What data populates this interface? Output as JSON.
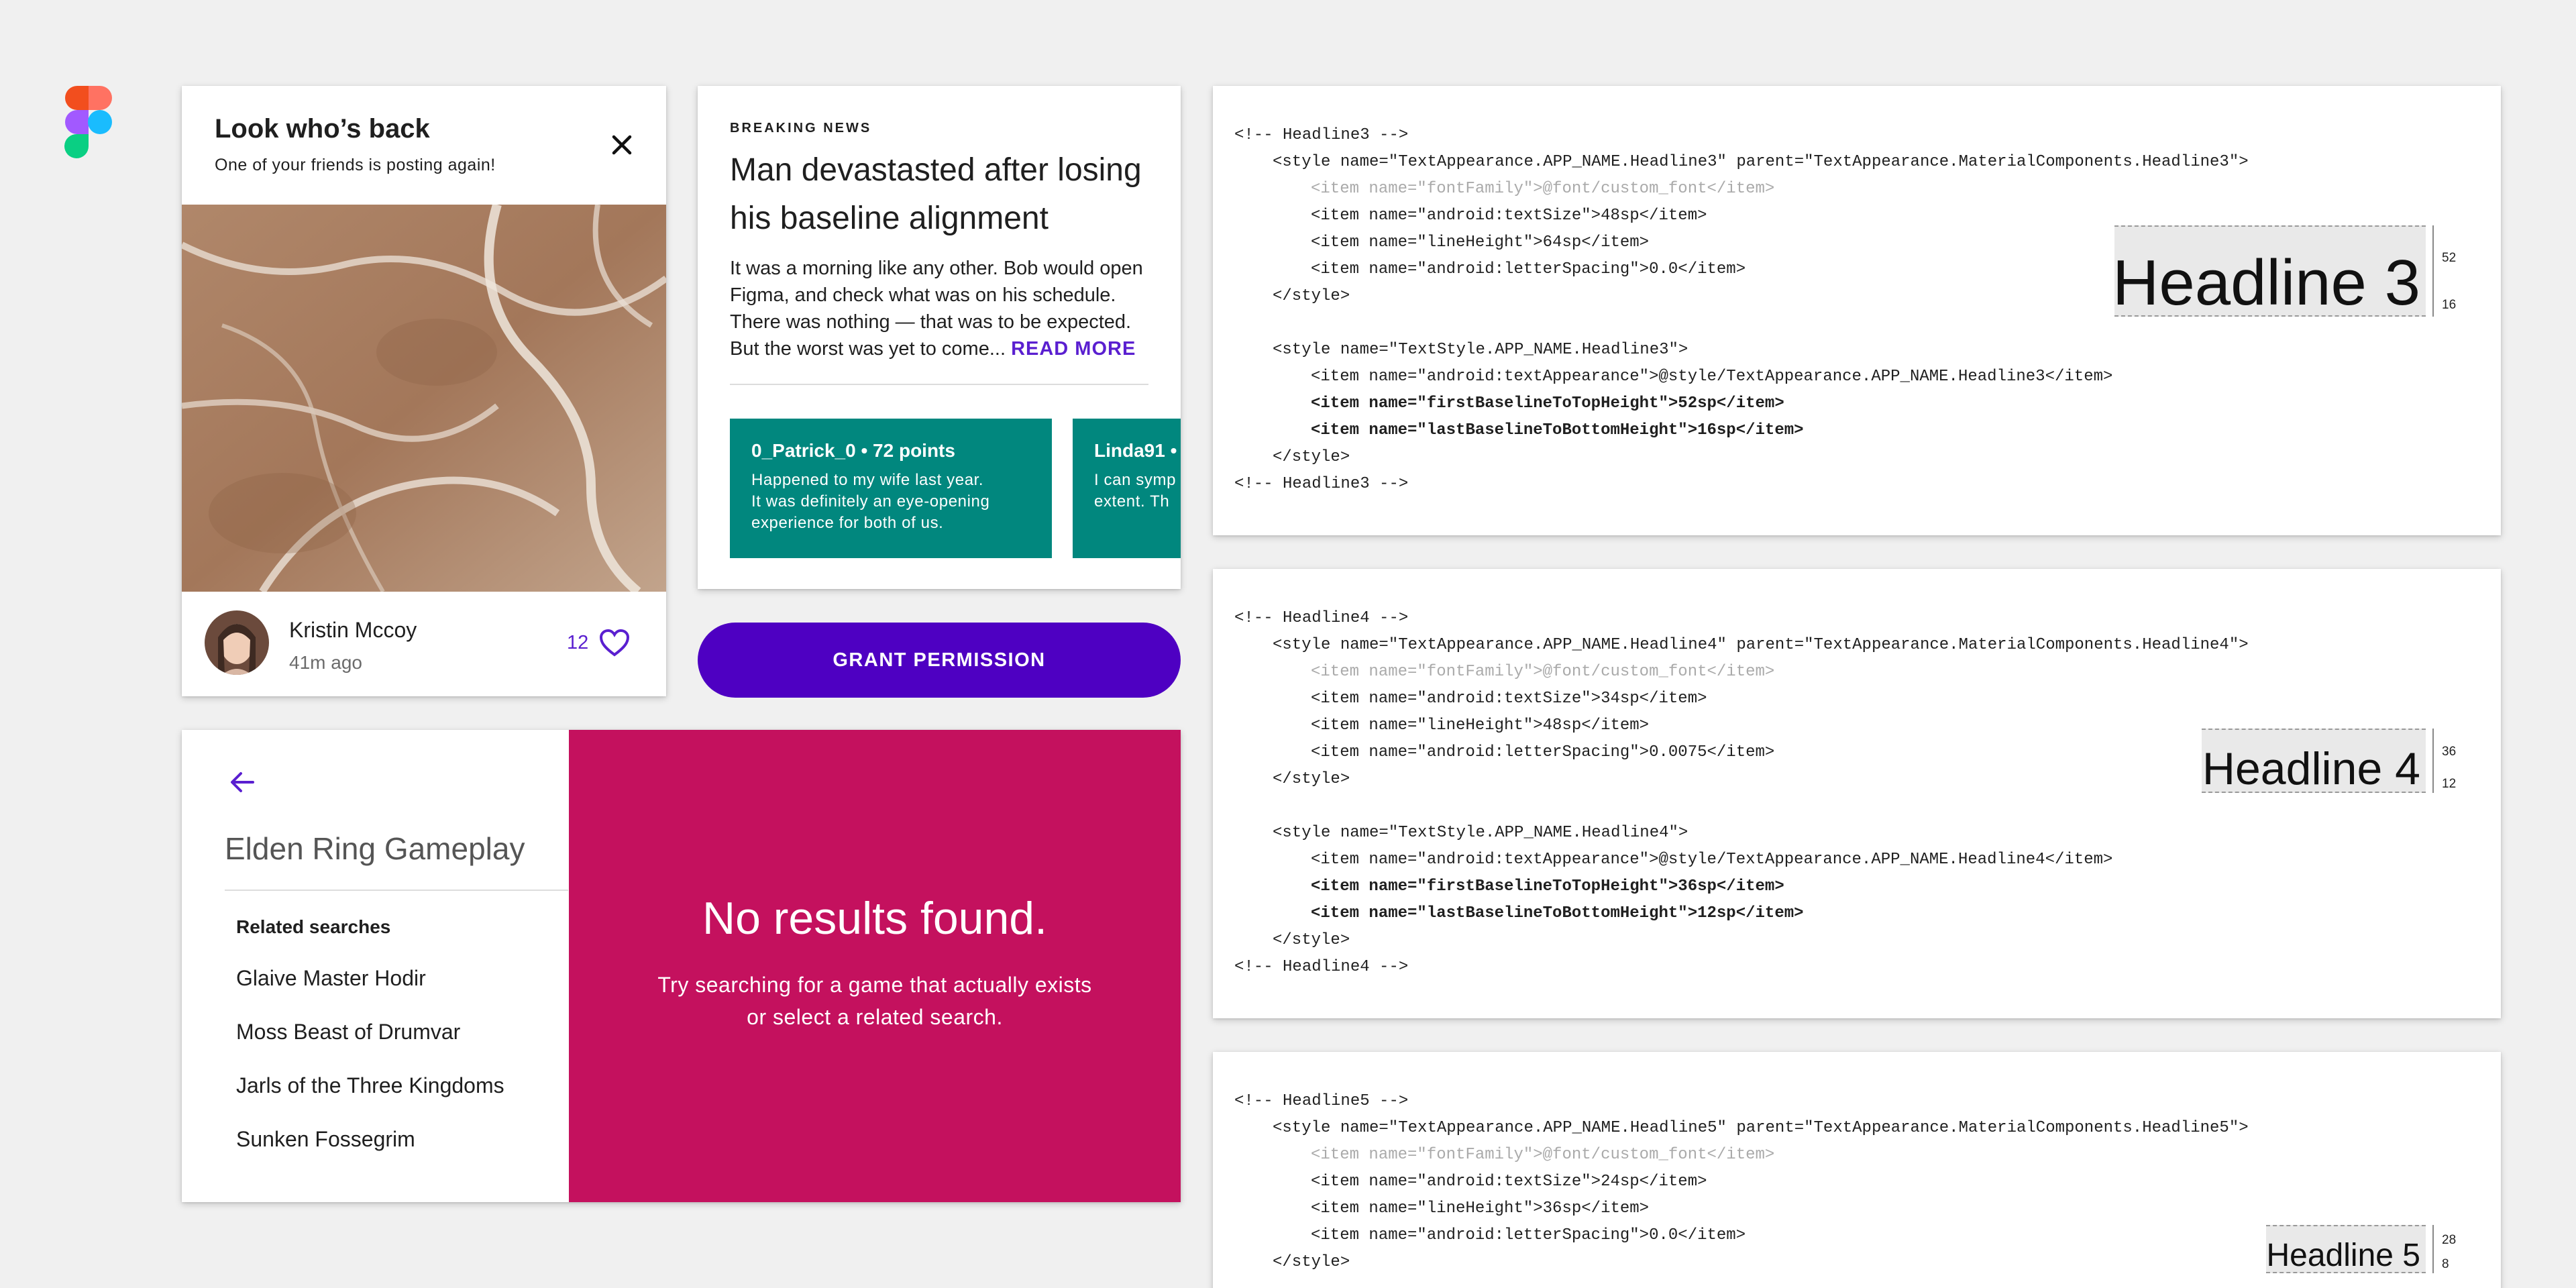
{
  "figma_logo": {
    "icon": "figma-logo-icon"
  },
  "card_back": {
    "title": "Look who’s back",
    "subtitle": "One of your friends is posting again!",
    "user_name": "Kristin Mccoy",
    "time": "41m ago",
    "likes": "12"
  },
  "news": {
    "overline": "BREAKING NEWS",
    "title": "Man devastasted after losing his baseline alignment",
    "body": "It was a morning like any other. Bob would open Figma, and check what was on his schedule. There was nothing — that was to be expected. But the worst was yet to come...",
    "read_more": "READ MORE",
    "comments": [
      {
        "header": "0_Patrick_0 • 72 points",
        "lines": [
          "Happened to my wife last year.",
          "It was definitely an eye-opening",
          "experience for both of us."
        ]
      },
      {
        "header": "Linda91 •",
        "lines": [
          "I can symp",
          "extent. Th"
        ]
      }
    ]
  },
  "grant_button": "GRANT PERMISSION",
  "search": {
    "query": "Elden Ring Gameplay",
    "related_heading": "Related searches",
    "related": [
      "Glaive Master Hodir",
      "Moss Beast of Drumvar",
      "Jarls of the Three Kingdoms",
      "Sunken Fossegrim"
    ],
    "no_results": "No results found.",
    "hint_line1": "Try searching for a game that actually exists",
    "hint_line2": "or select a related search."
  },
  "code3": {
    "lines": [
      "<!-- Headline3 -->",
      "<style name=\"TextAppearance.APP_NAME.Headline3\" parent=\"TextAppearance.MaterialComponents.Headline3\">",
      "<item name=\"fontFamily\">@font/custom_font</item>",
      "<item name=\"android:textSize\">48sp</item>",
      "<item name=\"lineHeight\">64sp</item>",
      "<item name=\"android:letterSpacing\">0.0</item>",
      "</style>",
      "<style name=\"TextStyle.APP_NAME.Headline3\">",
      "<item name=\"android:textAppearance\">@style/TextAppearance.APP_NAME.Headline3</item>",
      "<item name=\"firstBaselineToTopHeight\">52sp</item>",
      "<item name=\"lastBaselineToBottomHeight\">16sp</item>",
      "</style>",
      "<!-- Headline3 -->"
    ],
    "sample": "Headline 3",
    "top": "52",
    "bottom": "16"
  },
  "code4": {
    "lines": [
      "<!-- Headline4 -->",
      "<style name=\"TextAppearance.APP_NAME.Headline4\" parent=\"TextAppearance.MaterialComponents.Headline4\">",
      "<item name=\"fontFamily\">@font/custom_font</item>",
      "<item name=\"android:textSize\">34sp</item>",
      "<item name=\"lineHeight\">48sp</item>",
      "<item name=\"android:letterSpacing\">0.0075</item>",
      "</style>",
      "<style name=\"TextStyle.APP_NAME.Headline4\">",
      "<item name=\"android:textAppearance\">@style/TextAppearance.APP_NAME.Headline4</item>",
      "<item name=\"firstBaselineToTopHeight\">36sp</item>",
      "<item name=\"lastBaselineToBottomHeight\">12sp</item>",
      "</style>",
      "<!-- Headline4 -->"
    ],
    "sample": "Headline 4",
    "top": "36",
    "bottom": "12"
  },
  "code5": {
    "lines": [
      "<!-- Headline5 -->",
      "<style name=\"TextAppearance.APP_NAME.Headline5\" parent=\"TextAppearance.MaterialComponents.Headline5\">",
      "<item name=\"fontFamily\">@font/custom_font</item>",
      "<item name=\"android:textSize\">24sp</item>",
      "<item name=\"lineHeight\">36sp</item>",
      "<item name=\"android:letterSpacing\">0.0</item>",
      "</style>"
    ],
    "sample": "Headline 5",
    "top": "28",
    "bottom": "8"
  },
  "colors": {
    "primary": "#4e00c2",
    "accent_text": "#5a1fd0",
    "teal": "#01877e",
    "magenta": "#c4115e"
  }
}
